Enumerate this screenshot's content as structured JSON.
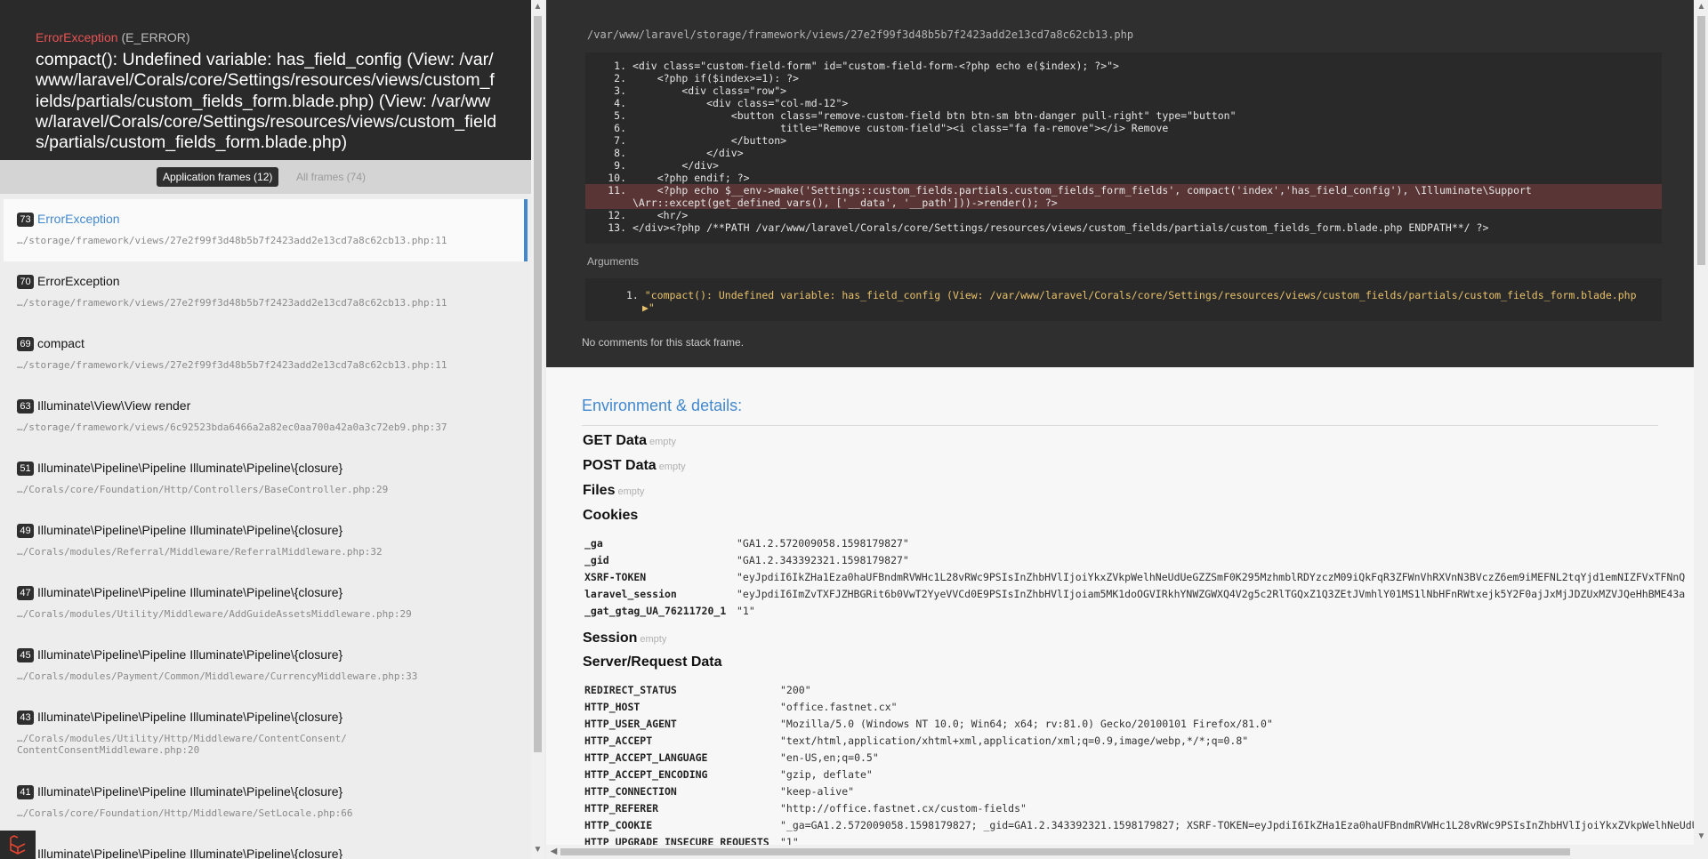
{
  "error": {
    "class": "ErrorException",
    "type": "(E_ERROR)",
    "message": "compact(): Undefined variable: has_field_config (View: /var/www/laravel/Corals/core/Settings/resources/views/custom_fields/partials/custom_fields_form.blade.php) (View: /var/www/laravel/Corals/core/Settings/resources/views/custom_fields/partials/custom_fields_form.blade.php)"
  },
  "tabs": {
    "application": "Application frames (12)",
    "all": "All frames (74)"
  },
  "frames": [
    {
      "num": "73",
      "cls": "ErrorException",
      "file": "…/storage/framework/views/27e2f99f3d48b5b7f2423add2e13cd7a8c62cb13.php:11"
    },
    {
      "num": "70",
      "cls": "ErrorException",
      "file": "…/storage/framework/views/27e2f99f3d48b5b7f2423add2e13cd7a8c62cb13.php:11"
    },
    {
      "num": "69",
      "cls": "compact",
      "file": "…/storage/framework/views/27e2f99f3d48b5b7f2423add2e13cd7a8c62cb13.php:11"
    },
    {
      "num": "63",
      "cls": "Illuminate\\View\\View render",
      "file": "…/storage/framework/views/6c92523bda6466a2a82ec0aa700a42a0a3c72eb9.php:37"
    },
    {
      "num": "51",
      "cls": "Illuminate\\Pipeline\\Pipeline Illuminate\\Pipeline\\{closure}",
      "file": "…/Corals/core/Foundation/Http/Controllers/BaseController.php:29"
    },
    {
      "num": "49",
      "cls": "Illuminate\\Pipeline\\Pipeline Illuminate\\Pipeline\\{closure}",
      "file": "…/Corals/modules/Referral/Middleware/ReferralMiddleware.php:32"
    },
    {
      "num": "47",
      "cls": "Illuminate\\Pipeline\\Pipeline Illuminate\\Pipeline\\{closure}",
      "file": "…/Corals/modules/Utility/Middleware/AddGuideAssetsMiddleware.php:29"
    },
    {
      "num": "45",
      "cls": "Illuminate\\Pipeline\\Pipeline Illuminate\\Pipeline\\{closure}",
      "file": "…/Corals/modules/Payment/Common/Middleware/CurrencyMiddleware.php:33"
    },
    {
      "num": "43",
      "cls": "Illuminate\\Pipeline\\Pipeline Illuminate\\Pipeline\\{closure}",
      "file": "…/Corals/modules/Utility/Http/Middleware/ContentConsent/ ContentConsentMiddleware.php:20"
    },
    {
      "num": "41",
      "cls": "Illuminate\\Pipeline\\Pipeline Illuminate\\Pipeline\\{closure}",
      "file": "…/Corals/core/Foundation/Http/Middleware/SetLocale.php:66"
    },
    {
      "num": "",
      "cls": "Illuminate\\Pipeline\\Pipeline Illuminate\\Pipeline\\{closure}",
      "file": ""
    }
  ],
  "code": {
    "file_path": "/var/www/laravel/storage/framework/views/27e2f99f3d48b5b7f2423add2e13cd7a8c62cb13.php",
    "line_numbers": [
      "1.",
      "2.",
      "3.",
      "4.",
      "5.",
      "6.",
      "7.",
      "8.",
      "9.",
      "10.",
      "11.",
      "",
      "12.",
      "13."
    ],
    "lines": [
      "<div class=\"custom-field-form\" id=\"custom-field-form-<?php echo e($index); ?>\">",
      "    <?php if($index>=1): ?>",
      "        <div class=\"row\">",
      "            <div class=\"col-md-12\">",
      "                <button class=\"remove-custom-field btn btn-sm btn-danger pull-right\" type=\"button\"",
      "                        title=\"Remove custom-field\"><i class=\"fa fa-remove\"></i> Remove",
      "                </button>",
      "            </div>",
      "        </div>",
      "    <?php endif; ?>",
      "    <?php echo $__env->make('Settings::custom_fields.partials.custom_fields_form_fields', compact('index','has_field_config'), \\Illuminate\\Support",
      "\\Arr::except(get_defined_vars(), ['__data', '__path']))->render(); ?>",
      "    <hr/>",
      "</div><?php /**PATH /var/www/laravel/Corals/core/Settings/resources/views/custom_fields/partials/custom_fields_form.blade.php ENDPATH**/ ?>"
    ]
  },
  "arguments": {
    "label": "Arguments",
    "num": "1.",
    "value": "\"compact(): Undefined variable: has_field_config (View: /var/www/laravel/Corals/core/Settings/resources/views/custom_fields/partials/custom_fields_form.blade.php",
    "expand": "▶\""
  },
  "no_comments": "No comments for this stack frame.",
  "env": {
    "title": "Environment & details:",
    "empty": "empty",
    "get": "GET Data",
    "post": "POST Data",
    "files": "Files",
    "cookies_title": "Cookies",
    "cookies": [
      {
        "k": "_ga",
        "v": "\"GA1.2.572009058.1598179827\""
      },
      {
        "k": "_gid",
        "v": "\"GA1.2.343392321.1598179827\""
      },
      {
        "k": "XSRF-TOKEN",
        "v": "\"eyJpdiI6IkZHa1Eza0haUFBndmRVWHc1L28vRWc9PSIsInZhbHVlIjoiYkxZVkpWelhNeUdUeGZZSmF0K295MzhmblRDYzczM09iQkFqR3ZFWnVhRXVnN3BVczZ6em9iMEFNL2tqYjd1emNIZFVxTFNnQ"
      },
      {
        "k": "laravel_session",
        "v": "\"eyJpdiI6ImZvTXFJZHBGRit6b0VwT2YyeVVCd0E9PSIsInZhbHVlIjoiam5MK1doOGVIRkhYNWZGWXQ4V2g5c2RlTGQxZ1Q3ZEtJVmhlY01MS1lNbHFnRWtxejk5Y2F0ajJxMjJDZUxMZVJQeHhBME43a"
      },
      {
        "k": "_gat_gtag_UA_76211720_1",
        "v": "\"1\""
      }
    ],
    "session": "Session",
    "server_title": "Server/Request Data",
    "server": [
      {
        "k": "REDIRECT_STATUS",
        "v": "\"200\""
      },
      {
        "k": "HTTP_HOST",
        "v": "\"office.fastnet.cx\""
      },
      {
        "k": "HTTP_USER_AGENT",
        "v": "\"Mozilla/5.0 (Windows NT 10.0; Win64; x64; rv:81.0) Gecko/20100101 Firefox/81.0\""
      },
      {
        "k": "HTTP_ACCEPT",
        "v": "\"text/html,application/xhtml+xml,application/xml;q=0.9,image/webp,*/*;q=0.8\""
      },
      {
        "k": "HTTP_ACCEPT_LANGUAGE",
        "v": "\"en-US,en;q=0.5\""
      },
      {
        "k": "HTTP_ACCEPT_ENCODING",
        "v": "\"gzip, deflate\""
      },
      {
        "k": "HTTP_CONNECTION",
        "v": "\"keep-alive\""
      },
      {
        "k": "HTTP_REFERER",
        "v": "\"http://office.fastnet.cx/custom-fields\""
      },
      {
        "k": "HTTP_COOKIE",
        "v": "\"_ga=GA1.2.572009058.1598179827; _gid=GA1.2.343392321.1598179827; XSRF-TOKEN=eyJpdiI6IkZHa1Eza0haUFBndmRVWHc1L28vRWc9PSIsInZhbHVlIjoiYkxZVkpWelhNeUdUeGZZSmF0K295Mzhm"
      },
      {
        "k": "HTTP_UPGRADE_INSECURE_REQUESTS",
        "v": "\"1\""
      }
    ]
  },
  "icons": {
    "laravel": "laravel-logo-icon",
    "scroll_up": "▲",
    "scroll_down": "▼",
    "scroll_left": "◀",
    "scroll_right": "▶"
  },
  "colors": {
    "accent": "#4288ce",
    "error": "#e95353",
    "dark_bg": "#2f2f2f"
  }
}
